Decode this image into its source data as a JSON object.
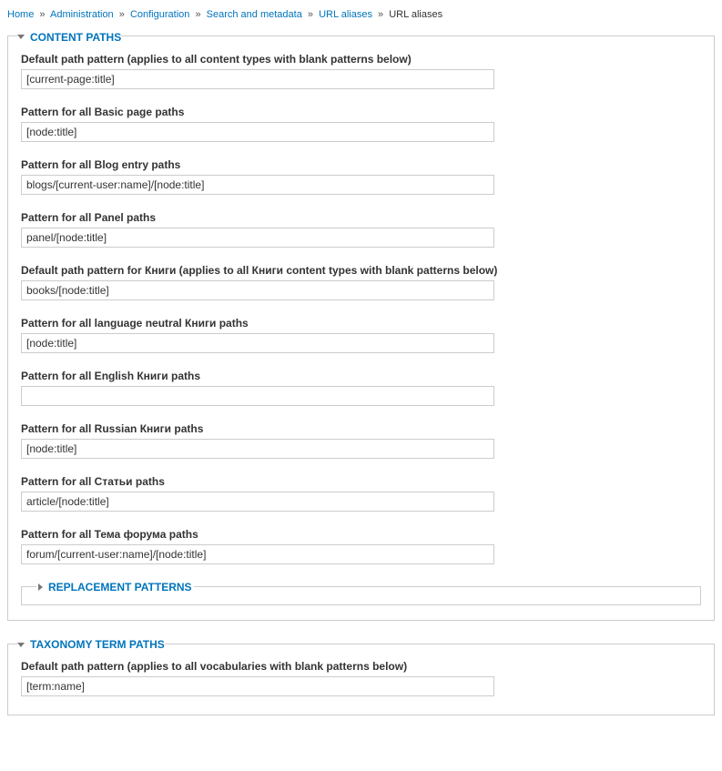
{
  "breadcrumb": {
    "items": [
      {
        "label": "Home",
        "link": true
      },
      {
        "label": "Administration",
        "link": true
      },
      {
        "label": "Configuration",
        "link": true
      },
      {
        "label": "Search and metadata",
        "link": true
      },
      {
        "label": "URL aliases",
        "link": true
      },
      {
        "label": "URL aliases",
        "link": false
      }
    ],
    "separator": "»"
  },
  "panels": {
    "content_paths": {
      "title": "CONTENT PATHS",
      "fields": [
        {
          "label": "Default path pattern (applies to all content types with blank patterns below)",
          "value": "[current-page:title]"
        },
        {
          "label": "Pattern for all Basic page paths",
          "value": "[node:title]"
        },
        {
          "label": "Pattern for all Blog entry paths",
          "value": "blogs/[current-user:name]/[node:title]"
        },
        {
          "label": "Pattern for all Panel paths",
          "value": "panel/[node:title]"
        },
        {
          "label": "Default path pattern for Книги (applies to all Книги content types with blank patterns below)",
          "value": "books/[node:title]"
        },
        {
          "label": "Pattern for all language neutral Книги paths",
          "value": "[node:title]"
        },
        {
          "label": "Pattern for all English Книги paths",
          "value": ""
        },
        {
          "label": "Pattern for all Russian Книги paths",
          "value": "[node:title]"
        },
        {
          "label": "Pattern for all Статьи paths",
          "value": "article/[node:title]"
        },
        {
          "label": "Pattern for all Тема форума paths",
          "value": "forum/[current-user:name]/[node:title]"
        }
      ],
      "replacement_title": "REPLACEMENT PATTERNS"
    },
    "taxonomy_paths": {
      "title": "TAXONOMY TERM PATHS",
      "fields": [
        {
          "label": "Default path pattern (applies to all vocabularies with blank patterns below)",
          "value": "[term:name]"
        }
      ]
    }
  }
}
